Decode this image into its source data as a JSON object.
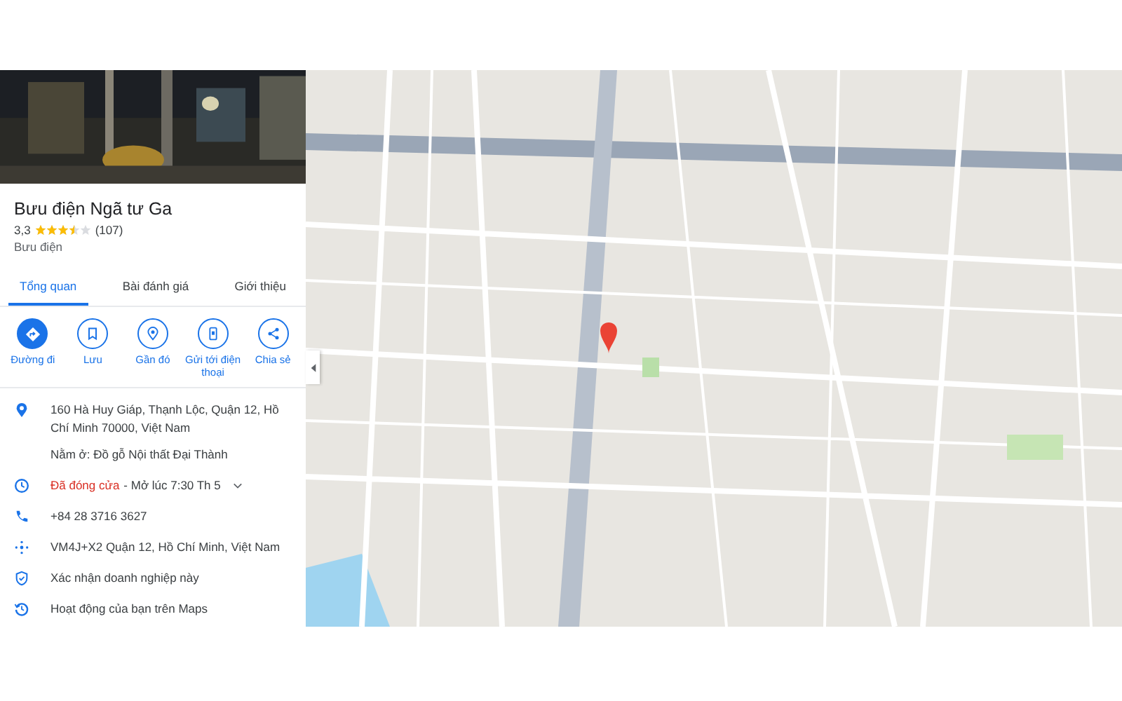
{
  "place": {
    "title": "Bưu điện Ngã tư Ga",
    "rating": "3,3",
    "stars": 3.5,
    "reviews": "(107)",
    "category": "Bưu điện"
  },
  "tabs": [
    {
      "label": "Tổng quan",
      "selected": true
    },
    {
      "label": "Bài đánh giá",
      "selected": false
    },
    {
      "label": "Giới thiệu",
      "selected": false
    }
  ],
  "actions": [
    {
      "kind": "directions",
      "label": "Đường đi"
    },
    {
      "kind": "save",
      "label": "Lưu"
    },
    {
      "kind": "nearby",
      "label": "Gần đó"
    },
    {
      "kind": "phone",
      "label": "Gửi tới điện thoại"
    },
    {
      "kind": "share",
      "label": "Chia sẻ"
    }
  ],
  "info": [
    {
      "kind": "address",
      "text": "160 Hà Huy Giáp, Thạnh Lộc, Quận 12, Hồ Chí Minh 70000, Việt Nam"
    },
    {
      "kind": "located",
      "text": "Nằm ở: Đồ gỗ Nội thất Đại Thành"
    },
    {
      "kind": "hours",
      "status": "Đã đóng cửa",
      "text": "- Mở lúc 7:30 Th 5",
      "expanded": false
    },
    {
      "kind": "phone",
      "text": "+84 28 3716 3627"
    },
    {
      "kind": "pluscode",
      "text": "VM4J+X2 Quận 12, Hồ Chí Minh, Việt Nam"
    },
    {
      "kind": "verify",
      "text": "Xác nhận doanh nghiệp này"
    },
    {
      "kind": "activity",
      "text": "Hoạt động của bạn trên Maps"
    }
  ]
}
